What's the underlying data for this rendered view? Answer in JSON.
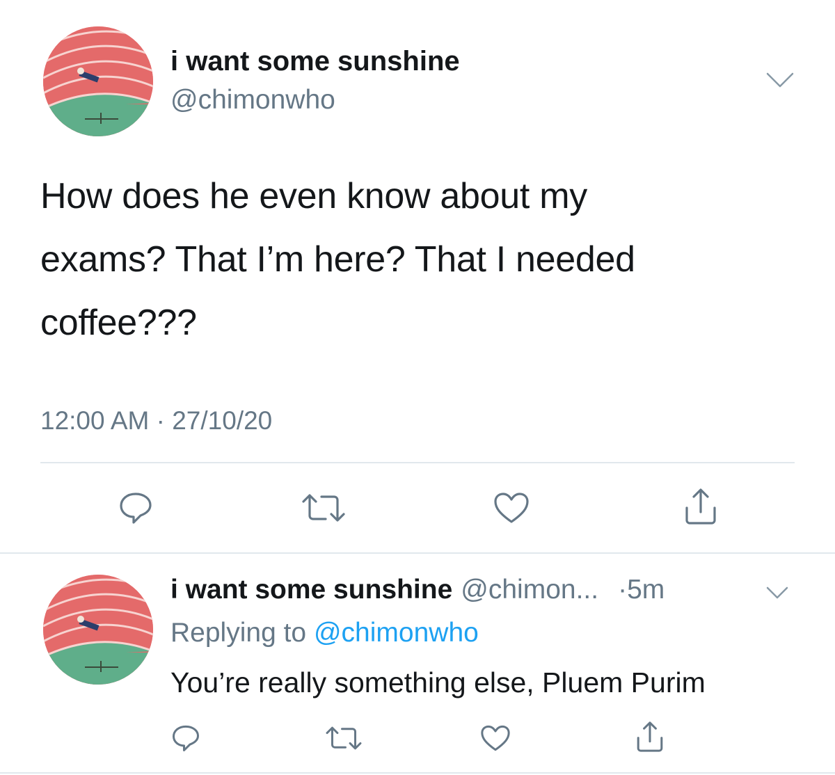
{
  "tweet": {
    "display_name": "i want some sunshine",
    "handle": "@chimonwho",
    "text_lines": [
      "How does he even know about my",
      "exams? That I’m here? That I needed",
      "coffee???"
    ],
    "time": "12:00 AM",
    "separator": "·",
    "date": "27/10/20",
    "actions": [
      "reply-icon",
      "retweet-icon",
      "like-icon",
      "share-icon"
    ]
  },
  "reply": {
    "display_name": "i want some sunshine",
    "handle_truncated": "@chimon...",
    "time": "·5m",
    "replying_prefix": "Replying to",
    "replying_mention": "@chimonwho",
    "text": "You’re really something else, Pluem Purim",
    "actions": [
      "reply-icon",
      "retweet-icon",
      "like-icon",
      "share-icon"
    ]
  },
  "colors": {
    "text_primary": "#14171a",
    "text_secondary": "#657786",
    "link": "#1da1f2",
    "divider": "#e1e8ed",
    "avatar_track": "#e46a6a",
    "avatar_field": "#5fae8a"
  }
}
